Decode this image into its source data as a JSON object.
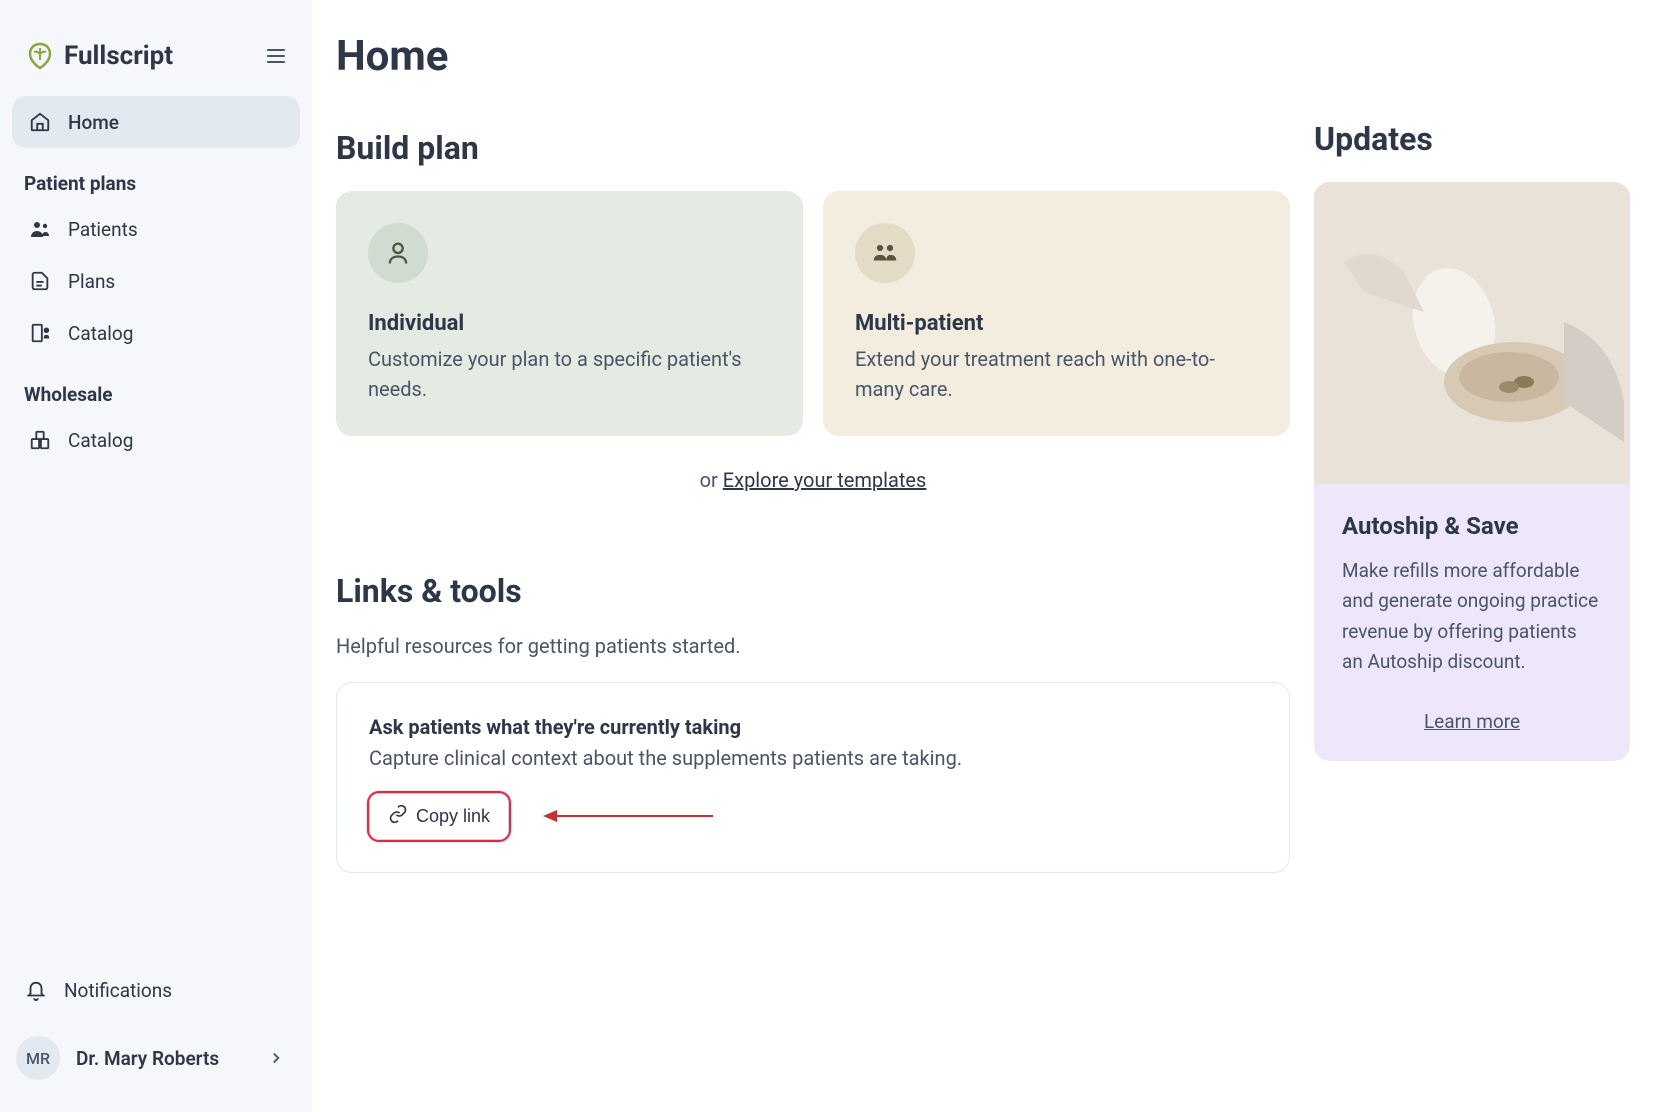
{
  "logo": {
    "text": "Fullscript"
  },
  "sidebar": {
    "nav": {
      "home": "Home",
      "patient_plans_title": "Patient plans",
      "patients": "Patients",
      "plans": "Plans",
      "catalog": "Catalog",
      "wholesale_title": "Wholesale",
      "wholesale_catalog": "Catalog"
    },
    "notifications": "Notifications",
    "user": {
      "initials": "MR",
      "name": "Dr. Mary Roberts"
    }
  },
  "page": {
    "title": "Home"
  },
  "build_plan": {
    "title": "Build plan",
    "individual": {
      "title": "Individual",
      "desc": "Customize your plan to a specific patient's needs."
    },
    "multi": {
      "title": "Multi-patient",
      "desc": "Extend your treatment reach with one-to-many care."
    },
    "templates_prefix": "or ",
    "templates_link": "Explore your templates"
  },
  "links_tools": {
    "title": "Links & tools",
    "subtitle": "Helpful resources for getting patients started.",
    "ask_patients": {
      "title": "Ask patients what they're currently taking",
      "desc": "Capture clinical context about the supplements patients are taking.",
      "copy_link": "Copy link"
    }
  },
  "updates": {
    "title": "Updates",
    "autoship": {
      "title": "Autoship & Save",
      "desc": "Make refills more affordable and generate ongoing practice revenue by offering patients an Autoship discount.",
      "learn_more": "Learn more"
    }
  }
}
